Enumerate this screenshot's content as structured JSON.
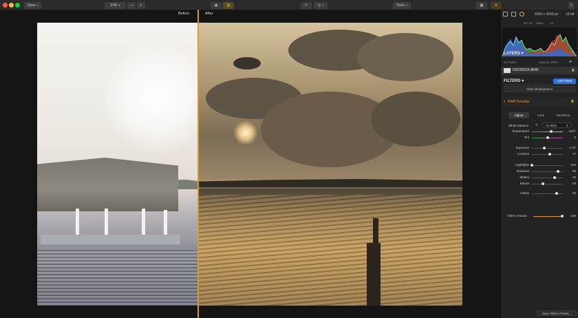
{
  "toolbar": {
    "open_label": "Open",
    "zoom_value": "24%",
    "minus_label": "—",
    "plus_label": "+",
    "tools_label": "Tools"
  },
  "compare": {
    "before_label": "Before",
    "after_label": "After"
  },
  "panel": {
    "dimensions": "6000 x 4000 px",
    "bit_depth": "16-bit",
    "histogram_info": {
      "iso": "ISO 100",
      "shutter": "1/80sec",
      "fstop": "f/4"
    },
    "layers": {
      "title": "LAYERS",
      "blend_mode": "Normal",
      "opacity_label": "Opacity 100%",
      "layer_name": "DSC05310.ARW"
    },
    "filters": {
      "title": "FILTERS",
      "add_label": "Add Filters",
      "clear_workspace": "Clear Workspace",
      "raw_develop": "RAW Develop",
      "tabs": [
        "Adjust",
        "Lens",
        "Transform"
      ],
      "white_balance_label": "White Balance",
      "white_balance_value": "As Shot",
      "sliders": [
        {
          "label": "Temperature",
          "value": "6227",
          "fraction": 0.62,
          "track": "temp"
        },
        {
          "label": "Tint",
          "value": "0",
          "fraction": 0.5,
          "track": "tint"
        },
        {
          "label": "Exposure",
          "value": "-1.87",
          "fraction": 0.4,
          "track": "plain"
        },
        {
          "label": "Contrast",
          "value": "17",
          "fraction": 0.58,
          "track": "plain"
        },
        {
          "label": "Highlights",
          "value": "-100",
          "fraction": 0.0,
          "track": "plain"
        },
        {
          "label": "Shadows",
          "value": "69",
          "fraction": 0.85,
          "track": "plain"
        },
        {
          "label": "Whites",
          "value": "46",
          "fraction": 0.73,
          "track": "plain"
        },
        {
          "label": "Blacks",
          "value": "-29",
          "fraction": 0.36,
          "track": "plain"
        },
        {
          "label": "Clarity",
          "value": "60",
          "fraction": 0.8,
          "track": "plain"
        }
      ],
      "filters_amount_label": "Filters Amount",
      "filters_amount_value": "100",
      "filters_amount_fraction": 1.0
    },
    "save_preset_label": "Save Filters Preset..."
  },
  "colors": {
    "accent": "#e89a2e",
    "primary_button": "#2f6fd6"
  }
}
